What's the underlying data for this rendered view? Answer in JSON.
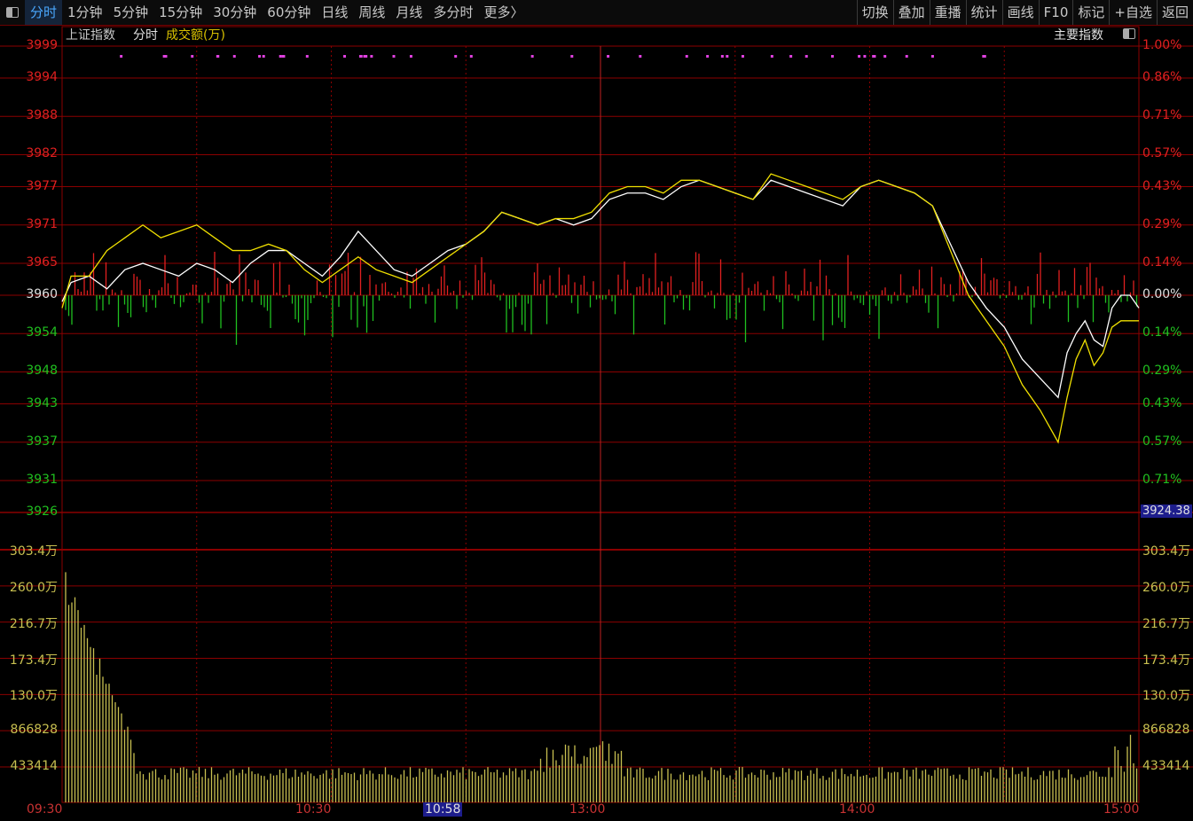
{
  "toolbar": {
    "left": [
      "分时",
      "1分钟",
      "5分钟",
      "15分钟",
      "30分钟",
      "60分钟",
      "日线",
      "周线",
      "月线",
      "多分时",
      "更多〉"
    ],
    "right": [
      "切换",
      "叠加",
      "重播",
      "统计",
      "画线",
      "F10",
      "标记",
      "+自选",
      "返回"
    ],
    "active_index": 0
  },
  "info": {
    "index_name": "上证指数",
    "mode": "分时",
    "metric": "成交额(万)",
    "main_index": "主要指数"
  },
  "price_axis": {
    "left": [
      "3999",
      "3994",
      "3988",
      "3982",
      "3977",
      "3971",
      "3965",
      "3960",
      "3954",
      "3948",
      "3943",
      "3937",
      "3931",
      "3926"
    ],
    "right": [
      "1.00%",
      "0.86%",
      "0.71%",
      "0.57%",
      "0.43%",
      "0.29%",
      "0.14%",
      "0.00%",
      "0.14%",
      "0.29%",
      "0.43%",
      "0.57%",
      "0.71%"
    ],
    "cursor_value": "3924.38",
    "levels": [
      3999,
      3994,
      3988,
      3982,
      3977,
      3971,
      3965,
      3960,
      3954,
      3948,
      3943,
      3937,
      3931,
      3926
    ]
  },
  "volume_axis": {
    "labels": [
      "303.4万",
      "260.0万",
      "216.7万",
      "173.4万",
      "130.0万",
      "866828",
      "433414"
    ]
  },
  "time_axis": {
    "labels": [
      "09:30",
      "10:30",
      "13:00",
      "14:00",
      "15:00"
    ],
    "cursor": "10:58"
  },
  "colors": {
    "white_line": "#ffffff",
    "yellow_line": "#f0e000",
    "up": "#e02020",
    "down": "#20c020",
    "grid": "#8b0000",
    "volume": "#c8c050",
    "marker": "#e040e0"
  },
  "chart_data": {
    "type": "line",
    "x_range": [
      0,
      240
    ],
    "ylim": [
      3926,
      3999
    ],
    "base_price": 3960,
    "series": [
      {
        "color": "white",
        "points": [
          [
            0,
            3959
          ],
          [
            2,
            3962
          ],
          [
            6,
            3963
          ],
          [
            10,
            3961
          ],
          [
            14,
            3964
          ],
          [
            18,
            3965
          ],
          [
            22,
            3964
          ],
          [
            26,
            3963
          ],
          [
            30,
            3965
          ],
          [
            34,
            3964
          ],
          [
            38,
            3962
          ],
          [
            42,
            3965
          ],
          [
            46,
            3967
          ],
          [
            50,
            3967
          ],
          [
            54,
            3965
          ],
          [
            58,
            3963
          ],
          [
            62,
            3966
          ],
          [
            66,
            3970
          ],
          [
            70,
            3967
          ],
          [
            74,
            3964
          ],
          [
            78,
            3963
          ],
          [
            82,
            3965
          ],
          [
            86,
            3967
          ],
          [
            90,
            3968
          ],
          [
            94,
            3970
          ],
          [
            98,
            3973
          ],
          [
            102,
            3972
          ],
          [
            106,
            3971
          ],
          [
            110,
            3972
          ],
          [
            114,
            3971
          ],
          [
            118,
            3972
          ],
          [
            122,
            3975
          ],
          [
            126,
            3976
          ],
          [
            130,
            3976
          ],
          [
            134,
            3975
          ],
          [
            138,
            3977
          ],
          [
            142,
            3978
          ],
          [
            146,
            3977
          ],
          [
            150,
            3976
          ],
          [
            154,
            3975
          ],
          [
            158,
            3978
          ],
          [
            162,
            3977
          ],
          [
            166,
            3976
          ],
          [
            170,
            3975
          ],
          [
            174,
            3974
          ],
          [
            178,
            3977
          ],
          [
            182,
            3978
          ],
          [
            186,
            3977
          ],
          [
            190,
            3976
          ],
          [
            194,
            3974
          ],
          [
            198,
            3968
          ],
          [
            202,
            3962
          ],
          [
            206,
            3958
          ],
          [
            210,
            3955
          ],
          [
            214,
            3950
          ],
          [
            218,
            3947
          ],
          [
            222,
            3944
          ],
          [
            224,
            3951
          ],
          [
            226,
            3954
          ],
          [
            228,
            3956
          ],
          [
            230,
            3953
          ],
          [
            232,
            3952
          ],
          [
            234,
            3958
          ],
          [
            236,
            3960
          ],
          [
            238,
            3960
          ],
          [
            240,
            3958
          ]
        ]
      },
      {
        "color": "yellow",
        "points": [
          [
            0,
            3958
          ],
          [
            2,
            3963
          ],
          [
            6,
            3963
          ],
          [
            10,
            3967
          ],
          [
            14,
            3969
          ],
          [
            18,
            3971
          ],
          [
            22,
            3969
          ],
          [
            26,
            3970
          ],
          [
            30,
            3971
          ],
          [
            34,
            3969
          ],
          [
            38,
            3967
          ],
          [
            42,
            3967
          ],
          [
            46,
            3968
          ],
          [
            50,
            3967
          ],
          [
            54,
            3964
          ],
          [
            58,
            3962
          ],
          [
            62,
            3964
          ],
          [
            66,
            3966
          ],
          [
            70,
            3964
          ],
          [
            74,
            3963
          ],
          [
            78,
            3962
          ],
          [
            82,
            3964
          ],
          [
            86,
            3966
          ],
          [
            90,
            3968
          ],
          [
            94,
            3970
          ],
          [
            98,
            3973
          ],
          [
            102,
            3972
          ],
          [
            106,
            3971
          ],
          [
            110,
            3972
          ],
          [
            114,
            3972
          ],
          [
            118,
            3973
          ],
          [
            122,
            3976
          ],
          [
            126,
            3977
          ],
          [
            130,
            3977
          ],
          [
            134,
            3976
          ],
          [
            138,
            3978
          ],
          [
            142,
            3978
          ],
          [
            146,
            3977
          ],
          [
            150,
            3976
          ],
          [
            154,
            3975
          ],
          [
            158,
            3979
          ],
          [
            162,
            3978
          ],
          [
            166,
            3977
          ],
          [
            170,
            3976
          ],
          [
            174,
            3975
          ],
          [
            178,
            3977
          ],
          [
            182,
            3978
          ],
          [
            186,
            3977
          ],
          [
            190,
            3976
          ],
          [
            194,
            3974
          ],
          [
            198,
            3967
          ],
          [
            202,
            3960
          ],
          [
            206,
            3956
          ],
          [
            210,
            3952
          ],
          [
            214,
            3946
          ],
          [
            218,
            3942
          ],
          [
            222,
            3937
          ],
          [
            224,
            3944
          ],
          [
            226,
            3950
          ],
          [
            228,
            3953
          ],
          [
            230,
            3949
          ],
          [
            232,
            3951
          ],
          [
            234,
            3955
          ],
          [
            236,
            3956
          ],
          [
            238,
            3956
          ],
          [
            240,
            3956
          ]
        ]
      }
    ]
  }
}
